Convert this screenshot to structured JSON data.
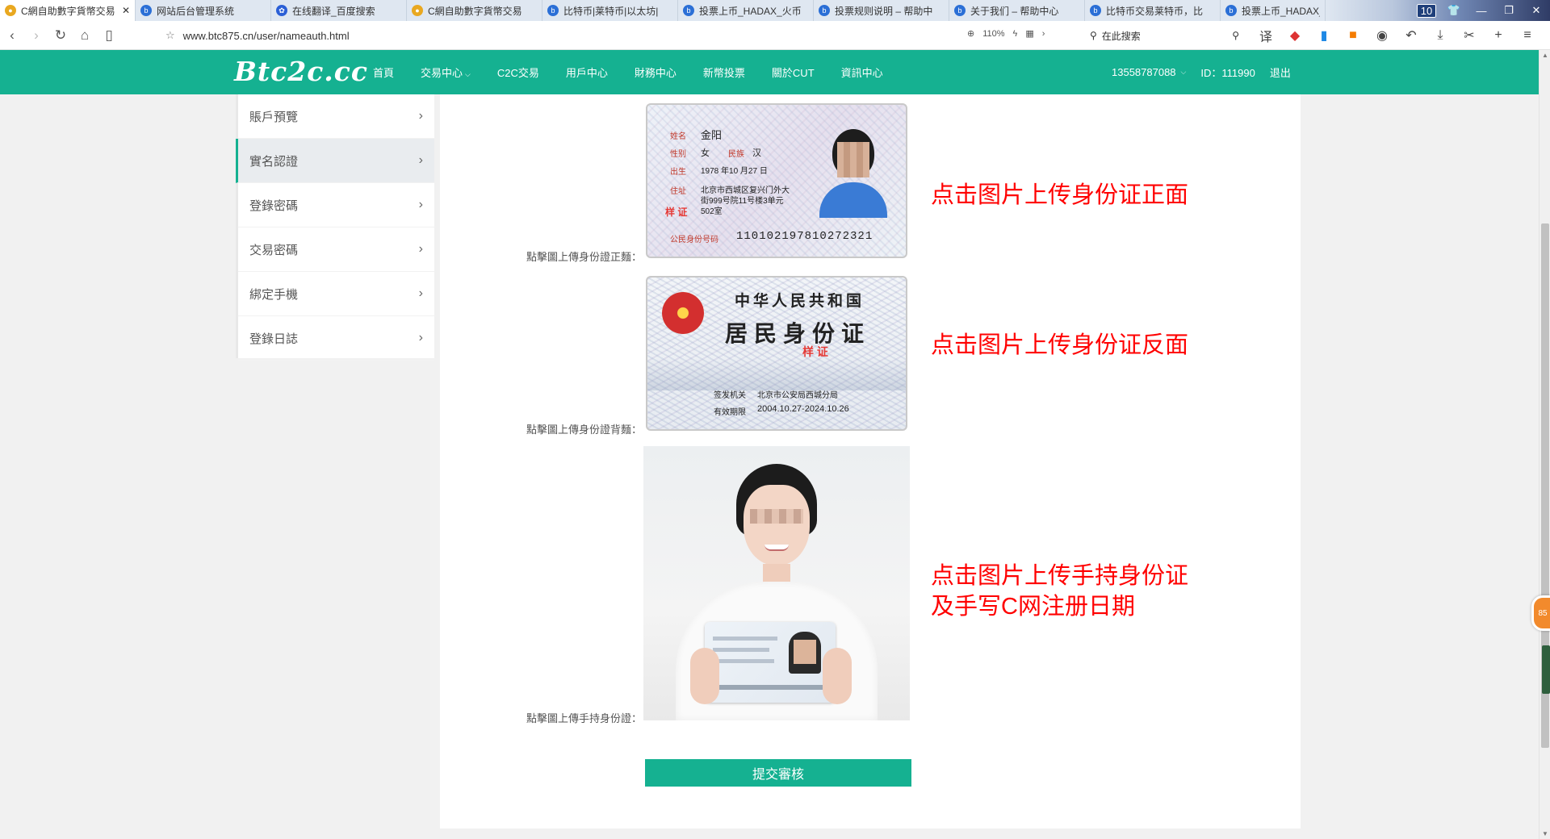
{
  "browser": {
    "tabs": [
      {
        "title": "C網自助數字貨幣交易",
        "active": true,
        "close": "✕"
      },
      {
        "title": "网站后台管理系统"
      },
      {
        "title": "在线翻译_百度搜索"
      },
      {
        "title": "C網自助數字貨幣交易"
      },
      {
        "title": "比特币|莱特币|以太坊|"
      },
      {
        "title": "投票上币_HADAX_火币"
      },
      {
        "title": "投票规则说明 – 帮助中"
      },
      {
        "title": "关于我们 – 帮助中心"
      },
      {
        "title": "比特币交易莱特币，比"
      },
      {
        "title": "投票上币_HADAX_火币"
      }
    ],
    "tab_count": "10",
    "url": "www.btc875.cn/user/nameauth.html",
    "zoom": "110%",
    "search_placeholder": "在此搜索",
    "tool_translate": "译"
  },
  "site": {
    "logo": "Btc2c.cc",
    "nav": [
      {
        "label": "首頁"
      },
      {
        "label": "交易中心",
        "dropdown": true
      },
      {
        "label": "C2C交易"
      },
      {
        "label": "用戶中心"
      },
      {
        "label": "財務中心"
      },
      {
        "label": "新幣投票"
      },
      {
        "label": "關於CUT"
      },
      {
        "label": "資訊中心"
      }
    ],
    "user_phone": "13558787088",
    "user_id": "ID：111990",
    "logout": "退出"
  },
  "sidebar": {
    "items": [
      {
        "label": "賬戶預覽"
      },
      {
        "label": "實名認證",
        "active": true
      },
      {
        "label": "登錄密碼"
      },
      {
        "label": "交易密碼"
      },
      {
        "label": "綁定手機"
      },
      {
        "label": "登錄日誌"
      }
    ]
  },
  "form": {
    "front_label": "點擊圖上傳身份證正麵：",
    "back_label": "點擊圖上傳身份證背麵：",
    "hold_label": "點擊圖上傳手持身份證：",
    "submit": "提交審核"
  },
  "id_front": {
    "name_key": "姓名",
    "name_val": "金阳",
    "sex_key": "性别",
    "sex_val": "女",
    "eth_key": "民族",
    "eth_val": "汉",
    "birth_key": "出生",
    "birth_val": "1978 年10 月27 日",
    "addr_key": "住址",
    "addr_l1": "北京市西城区复兴门外大",
    "addr_l2": "街999号院11号楼3单元",
    "addr_l3": "502室",
    "stamp": "样 证",
    "idno_key": "公民身份号码",
    "idno_val": "110102197810272321"
  },
  "id_back": {
    "country": "中华人民共和国",
    "title": "居民身份证",
    "stamp": "样 证",
    "authority_key": "签发机关",
    "authority_val": "北京市公安局西城分局",
    "valid_key": "有效期限",
    "valid_val": "2004.10.27-2024.10.26"
  },
  "annotations": {
    "front": "点击图片上传身份证正面",
    "back": "点击图片上传身份证反面",
    "hold_l1": "点击图片上传手持身份证",
    "hold_l2": "及手写C网注册日期"
  },
  "floating_badge": "85",
  "colors": {
    "brand": "#15b191",
    "annotation": "#ff0000"
  }
}
